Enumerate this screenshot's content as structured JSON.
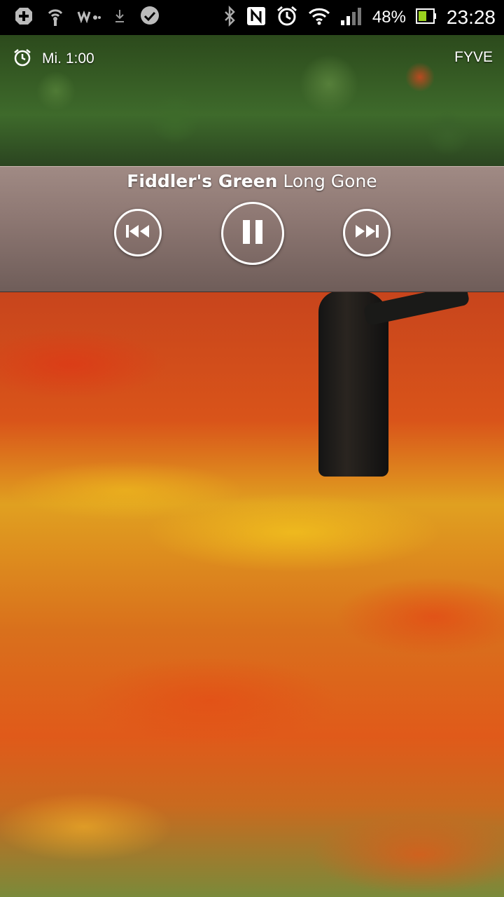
{
  "status_bar": {
    "time": "23:28",
    "battery_percent": "48%",
    "icons": [
      "add-icon",
      "wifi-signal-icon",
      "walkman-icon",
      "download-icon",
      "messenger-icon",
      "bluetooth-icon",
      "nfc-icon",
      "alarm-icon",
      "wifi-icon",
      "cellular-signal-icon",
      "battery-icon"
    ]
  },
  "lockscreen": {
    "alarm_text": "Mi. 1:00",
    "carrier": "FYVE"
  },
  "music_widget": {
    "track_title": "Fiddler's Green",
    "track_artist": "Long Gone",
    "controls": [
      "previous",
      "pause",
      "next"
    ]
  },
  "colors": {
    "widget_bg": "#8e7873",
    "status_bar_bg": "#000000",
    "text": "#ffffff"
  }
}
